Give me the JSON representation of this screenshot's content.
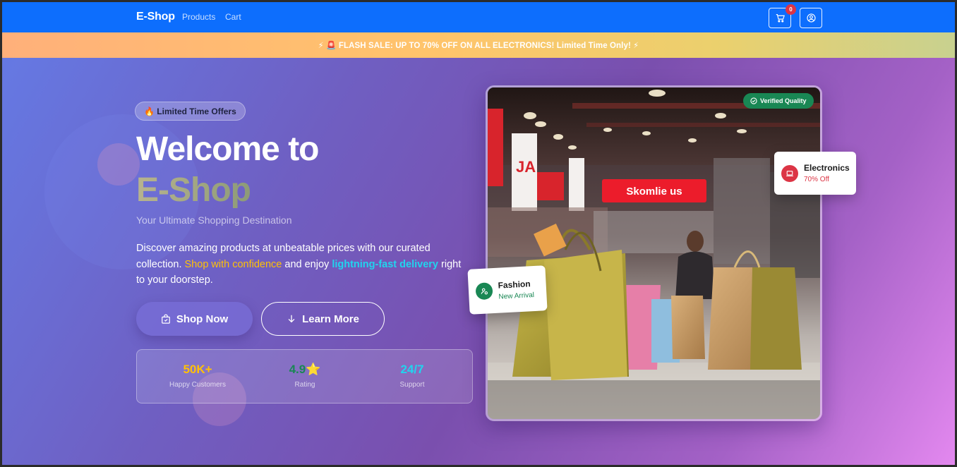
{
  "navbar": {
    "brand": "E-Shop",
    "links": [
      "Products",
      "Cart"
    ],
    "cart_count": "0",
    "cart_icon": "cart-icon",
    "user_icon": "user-circle-icon",
    "color": "#0d6efd"
  },
  "flash": {
    "text": "⚡ 🚨 FLASH SALE: UP TO 70% OFF ON ALL ELECTRONICS! Limited Time Only! ⚡"
  },
  "hero": {
    "pill": "🔥 Limited Time Offers",
    "title_line1": "Welcome to",
    "title_line2": "E-Shop",
    "subtitle": "Your Ultimate Shopping Destination",
    "desc_part1": "Discover amazing products at unbeatable prices with our curated collection. ",
    "desc_highlight1": "Shop with confidence",
    "desc_part2": " and enjoy ",
    "desc_highlight2": "lightning-fast delivery",
    "desc_part3": " right to your doorstep.",
    "shop_button": "Shop Now",
    "learn_button": "Learn More",
    "stats": [
      {
        "value": "50K+",
        "label": "Happy Customers",
        "color": "#ffc107"
      },
      {
        "value": "4.9⭐",
        "label": "Rating",
        "color": "#198754"
      },
      {
        "value": "24/7",
        "label": "Support",
        "color": "#21d4ee"
      }
    ]
  },
  "showcase": {
    "verified_badge": "Verified Quality",
    "store_sign": "Skomlie us",
    "electronics": {
      "title": "Electronics",
      "subtitle": "70% Off",
      "color": "#dc3545"
    },
    "fashion": {
      "title": "Fashion",
      "subtitle": "New Arrival",
      "color": "#198754"
    }
  }
}
